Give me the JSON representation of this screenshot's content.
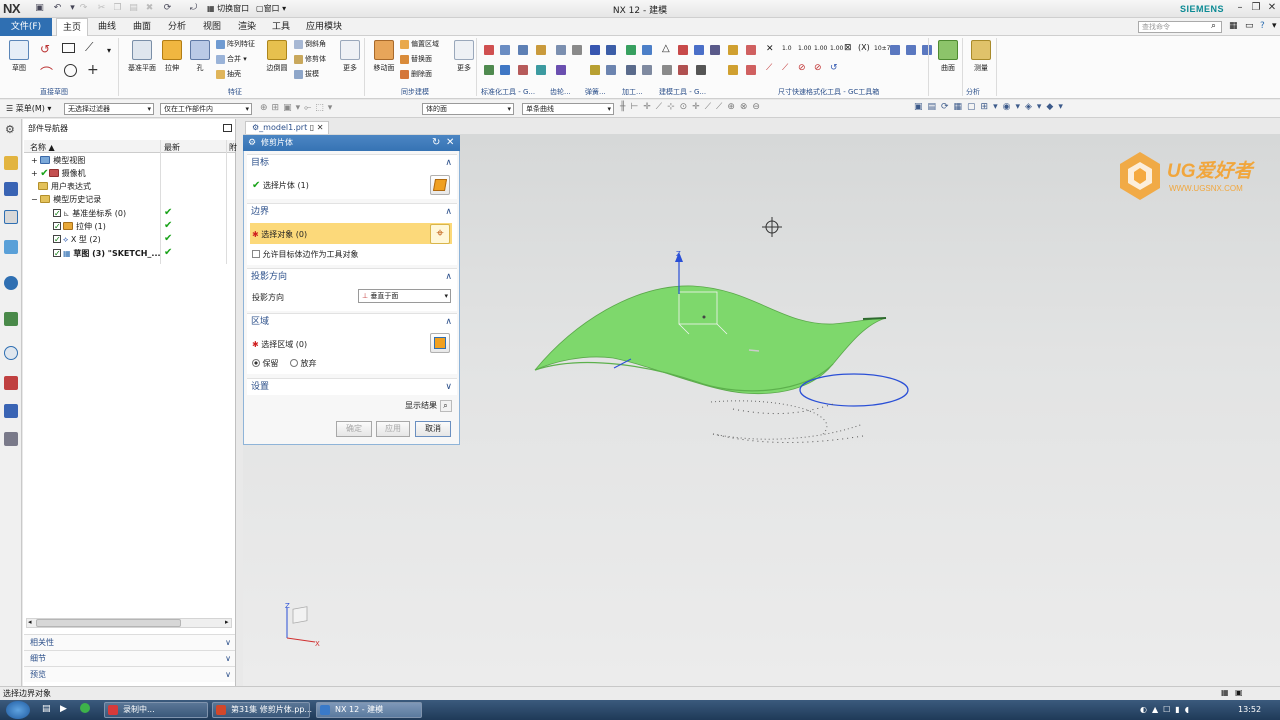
{
  "app": {
    "logo": "NX",
    "title": "NX 12 - 建模",
    "brand": "SIEMENS"
  },
  "search": {
    "placeholder": "查找命令"
  },
  "menu": {
    "file": "文件(F)",
    "tabs": [
      "主页",
      "曲线",
      "曲面",
      "分析",
      "视图",
      "渲染",
      "工具",
      "应用模块"
    ]
  },
  "quick_access": {
    "switch_window": "切换窗口",
    "window": "窗口"
  },
  "ribbon": {
    "sketch": {
      "label": "草图"
    },
    "direct_sketch_group": "直接草图",
    "datum_plane": "基准平面",
    "extrude": "拉伸",
    "hole": "孔",
    "feature_small": [
      "阵列特征",
      "合并",
      "抽壳"
    ],
    "blend": "边倒圆",
    "feature_small2": [
      "倒斜角",
      "修剪体",
      "拔模"
    ],
    "more1": "更多",
    "feature_group": "特征",
    "move_face": "移动面",
    "sync_small": [
      "偏置区域",
      "替换面",
      "删除面"
    ],
    "more2": "更多",
    "sync_group": "同步建模",
    "groups_mid": [
      "标准化工具 - G...",
      "齿轮...",
      "弹簧...",
      "加工...",
      "建模工具 - G..."
    ],
    "pmi_group": "尺寸快速格式化工具 - GC工具箱",
    "surface": "曲面",
    "measure": "测量",
    "analysis_group": "分析"
  },
  "toolbar2": {
    "menu": "菜单(M)",
    "filter": "无选择过滤器",
    "scope": "仅在工作部件内",
    "face_rule": "体的面",
    "curve_rule": "单条曲线"
  },
  "navigator": {
    "title": "部件导航器",
    "col_name": "名称",
    "col_latest": "最新",
    "col_extra": "附",
    "items": [
      {
        "label": "模型视图",
        "latest": ""
      },
      {
        "label": "摄像机",
        "latest": ""
      },
      {
        "label": "用户表达式",
        "latest": ""
      },
      {
        "label": "模型历史记录",
        "latest": ""
      },
      {
        "label": "基准坐标系 (0)",
        "latest": "✔"
      },
      {
        "label": "拉伸 (1)",
        "latest": "✔"
      },
      {
        "label": "X 型 (2)",
        "latest": "✔"
      },
      {
        "label": "草图 (3) \"SKETCH_...",
        "latest": "✔"
      }
    ],
    "bottom": [
      "相关性",
      "细节",
      "预览"
    ]
  },
  "file_tab": "_model1.prt",
  "dialog": {
    "title": "修剪片体",
    "target": {
      "header": "目标",
      "select_sheet": "选择片体 (1)"
    },
    "boundary": {
      "header": "边界",
      "select_object": "选择对象 (0)",
      "allow_edge": "允许目标体边作为工具对象"
    },
    "projection": {
      "header": "投影方向",
      "label": "投影方向",
      "value": "垂直于面"
    },
    "region": {
      "header": "区域",
      "select_region": "选择区域 (0)",
      "keep": "保留",
      "discard": "放弃"
    },
    "settings": {
      "header": "设置"
    },
    "show_result": "显示结果",
    "buttons": {
      "ok": "确定",
      "apply": "应用",
      "cancel": "取消"
    }
  },
  "viewport": {
    "watermark_title": "UG爱好者",
    "watermark_url": "WWW.UGSNX.COM",
    "axis_z": "Z",
    "triad": {
      "z": "Z",
      "x": "X"
    },
    "surface_color": "#7ed86c"
  },
  "status": {
    "text": "选择边界对象"
  },
  "taskbar": {
    "tasks": [
      "录制中...",
      "第31集 修剪片体.pp...",
      "NX 12 - 建模"
    ],
    "clock": "13:52"
  }
}
